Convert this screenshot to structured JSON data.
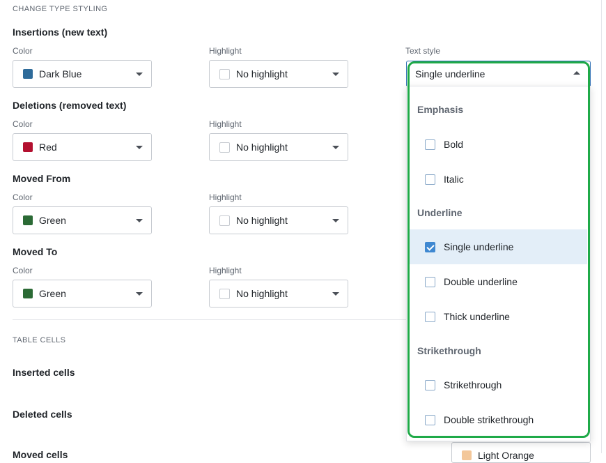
{
  "section_change_type": "CHANGE TYPE STYLING",
  "labels": {
    "color": "Color",
    "highlight": "Highlight",
    "text_style": "Text style"
  },
  "groups": [
    {
      "title": "Insertions (new text)",
      "color": "Dark Blue",
      "color_hex": "#2e6b9a",
      "highlight": "No highlight"
    },
    {
      "title": "Deletions (removed text)",
      "color": "Red",
      "color_hex": "#b3102f",
      "highlight": "No highlight"
    },
    {
      "title": "Moved From",
      "color": "Green",
      "color_hex": "#2b6a35",
      "highlight": "No highlight"
    },
    {
      "title": "Moved To",
      "color": "Green",
      "color_hex": "#2b6a35",
      "highlight": "No highlight"
    }
  ],
  "text_style": {
    "selected": "Single underline",
    "dropdown": {
      "groups": [
        {
          "label": "Emphasis",
          "options": [
            {
              "label": "Bold",
              "checked": false
            },
            {
              "label": "Italic",
              "checked": false
            }
          ]
        },
        {
          "label": "Underline",
          "options": [
            {
              "label": "Single underline",
              "checked": true
            },
            {
              "label": "Double underline",
              "checked": false
            },
            {
              "label": "Thick underline",
              "checked": false
            }
          ]
        },
        {
          "label": "Strikethrough",
          "options": [
            {
              "label": "Strikethrough",
              "checked": false
            },
            {
              "label": "Double strikethrough",
              "checked": false
            }
          ]
        }
      ]
    }
  },
  "section_table_cells": "TABLE CELLS",
  "table_cells": {
    "inserted": "Inserted cells",
    "deleted": "Deleted cells",
    "moved": "Moved cells"
  },
  "peek_select": {
    "value": "Light Orange",
    "color_hex": "#f3c79a"
  },
  "colors": {
    "accent": "#2f6fb5",
    "focus_ring": "#1faa48",
    "selected_bg": "#e3eef8"
  }
}
